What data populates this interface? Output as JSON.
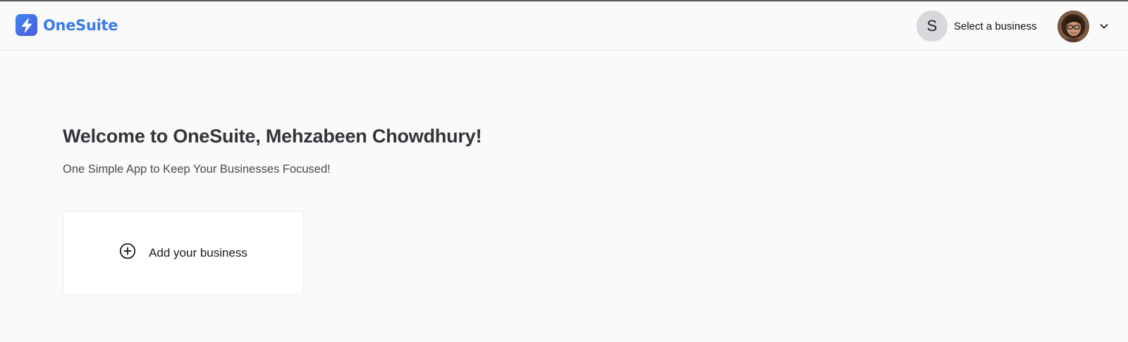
{
  "app": {
    "name": "OneSuite",
    "brand_color": "#3b7be6"
  },
  "header": {
    "business_selector": {
      "avatar_initial": "S",
      "label": "Select a business",
      "icon": "chevron-down-icon"
    },
    "user_menu": {
      "icon": "chevron-down-icon"
    }
  },
  "main": {
    "welcome": "Welcome to OneSuite, Mehzabeen Chowdhury!",
    "tagline": "One Simple App to Keep Your Businesses Focused!",
    "add_business": {
      "label": "Add your business",
      "icon": "plus-circle-icon"
    }
  }
}
